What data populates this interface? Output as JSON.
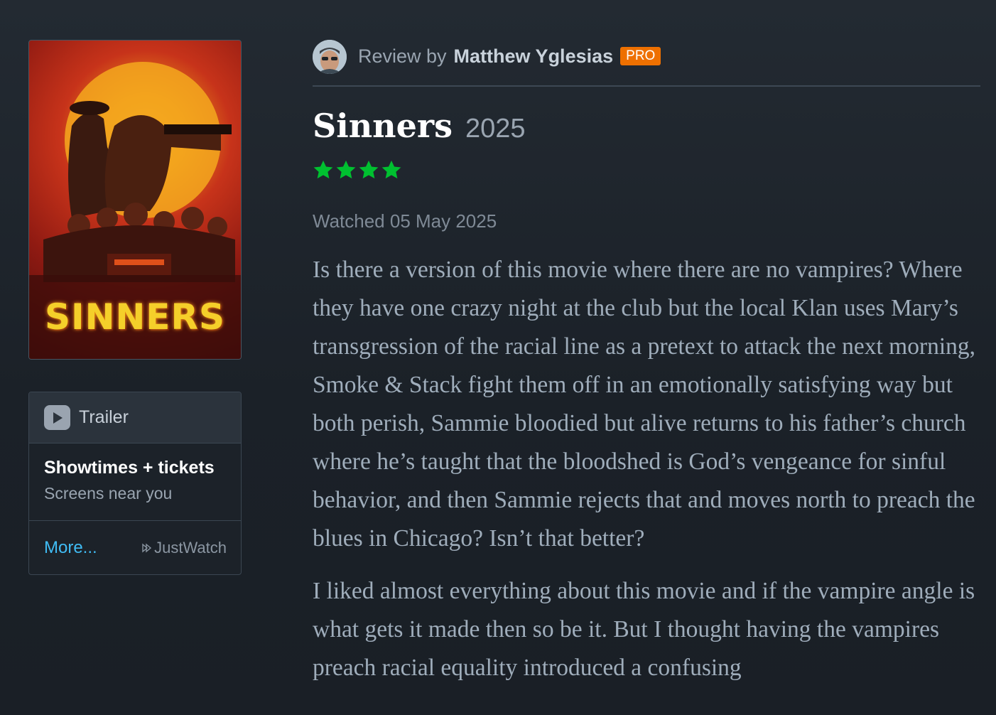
{
  "poster": {
    "title_text": "SINNERS"
  },
  "sidebar": {
    "trailer_label": "Trailer",
    "showtimes_title": "Showtimes + tickets",
    "showtimes_subtitle": "Screens near you",
    "more_label": "More...",
    "provider_label": "JustWatch"
  },
  "review": {
    "by_prefix": "Review by",
    "reviewer_name": "Matthew Yglesias",
    "badge": "PRO",
    "film_title": "Sinners",
    "film_year": "2025",
    "rating_stars": 4,
    "rating_max": 5,
    "star_color": "#00c030",
    "watched_text": "Watched 05 May 2025",
    "paragraphs": [
      "Is there a version of this movie where there are no vampires? Where they have one crazy night at the club but the local Klan uses Mary’s transgression of the racial line as a pretext to attack the next morning, Smoke & Stack fight them off in an emotionally satisfying way but both perish, Sammie bloodied but alive returns to his father’s church where he’s taught that the bloodshed is God’s vengeance for sinful behavior, and then Sammie rejects that and moves north to preach the blues in Chicago? Isn’t that better?",
      "I liked almost everything about this movie and if the vampire angle is what gets it made then so be it. But I thought having the vampires preach racial equality introduced a confusing"
    ]
  },
  "colors": {
    "background": "#1e252d",
    "accent_link": "#40bcf4",
    "pro_badge": "#ee7000"
  },
  "icons": [
    "play-icon",
    "justwatch-icon",
    "star-icon"
  ]
}
